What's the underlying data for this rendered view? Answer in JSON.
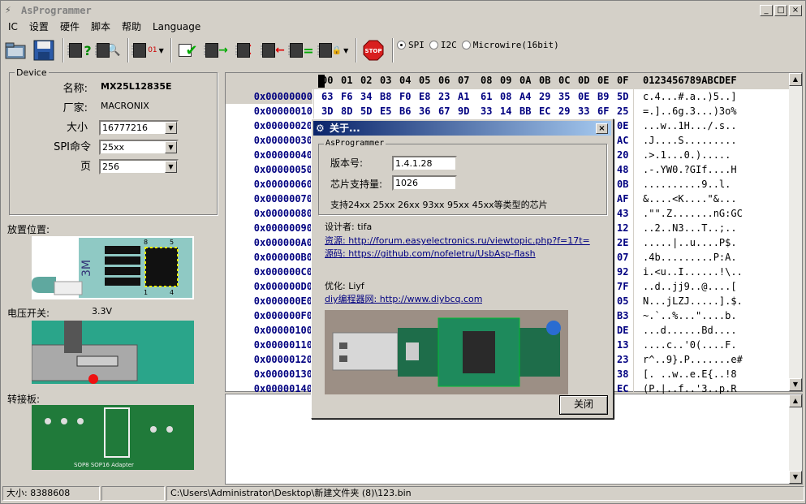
{
  "window": {
    "title": "AsProgrammer",
    "min": "_",
    "max": "□",
    "close": "×"
  },
  "menu": [
    "IC",
    "设置",
    "硬件",
    "脚本",
    "帮助",
    "Language"
  ],
  "toolbar": {
    "stop_label": "STOP",
    "protocols": [
      {
        "label": "SPI",
        "selected": true
      },
      {
        "label": "I2C",
        "selected": false
      },
      {
        "label": "Microwire(16bit)",
        "selected": false
      }
    ]
  },
  "device": {
    "legend": "Device",
    "name_label": "名称:",
    "name_value": "MX25L12835E",
    "vendor_label": "厂家:",
    "vendor_value": "MACRONIX",
    "size_label": "大小",
    "size_value": "16777216",
    "spi_label": "SPI命令",
    "spi_value": "25xx",
    "page_label": "页",
    "page_value": "256"
  },
  "left": {
    "placement_label": "放置位置:",
    "voltage_label": "电压开关:",
    "voltage_value": "3.3V",
    "adapter_label": "转接板:",
    "chip_pin_8": "8",
    "chip_pin_5": "5",
    "chip_pin_1": "1",
    "chip_pin_4": "4",
    "chip_logo": "3M",
    "board_text": "SOP8 SOP16 Adapter"
  },
  "hex": {
    "header_cols": [
      "00",
      "01",
      "02",
      "03",
      "04",
      "05",
      "06",
      "07",
      "08",
      "09",
      "0A",
      "0B",
      "0C",
      "0D",
      "0E",
      "0F"
    ],
    "ascii_header": "0123456789ABCDEF",
    "rows": [
      {
        "addr": "0x00000000",
        "bytes": [
          "63",
          "F6",
          "34",
          "B8",
          "F0",
          "E8",
          "23",
          "A1",
          "61",
          "08",
          "A4",
          "29",
          "35",
          "0E",
          "B9",
          "5D"
        ],
        "ascii": "c.4...#.a..)5..]"
      },
      {
        "addr": "0x00000010",
        "bytes": [
          "3D",
          "8D",
          "5D",
          "E5",
          "B6",
          "36",
          "67",
          "9D",
          "33",
          "14",
          "BB",
          "EC",
          "29",
          "33",
          "6F",
          "25"
        ],
        "ascii": "=.]..6g.3...)3o%"
      },
      {
        "addr": "0x00000020",
        "bytes": [
          "",
          "",
          "",
          "",
          "",
          "",
          "",
          "",
          "",
          "",
          "",
          "",
          "",
          "",
          "",
          "0E"
        ],
        "ascii": "...w..1H.../.s.."
      },
      {
        "addr": "0x00000030",
        "bytes": [
          "",
          "",
          "",
          "",
          "",
          "",
          "",
          "",
          "",
          "",
          "",
          "",
          "",
          "",
          "",
          "AC"
        ],
        "ascii": ".J....S........."
      },
      {
        "addr": "0x00000040",
        "bytes": [
          "",
          "",
          "",
          "",
          "",
          "",
          "",
          "",
          "",
          "",
          "",
          "",
          "",
          "",
          "",
          "20"
        ],
        "ascii": ".>.1...0.)....."
      },
      {
        "addr": "0x00000050",
        "bytes": [
          "",
          "",
          "",
          "",
          "",
          "",
          "",
          "",
          "",
          "",
          "",
          "",
          "",
          "",
          "",
          "48"
        ],
        "ascii": ".-.YW0.?GIf....H"
      },
      {
        "addr": "0x00000060",
        "bytes": [
          "",
          "",
          "",
          "",
          "",
          "",
          "",
          "",
          "",
          "",
          "",
          "",
          "",
          "",
          "",
          "0B"
        ],
        "ascii": "..........9..l."
      },
      {
        "addr": "0x00000070",
        "bytes": [
          "",
          "",
          "",
          "",
          "",
          "",
          "",
          "",
          "",
          "",
          "",
          "",
          "",
          "",
          "",
          "AF"
        ],
        "ascii": "&....<K....\"&..."
      },
      {
        "addr": "0x00000080",
        "bytes": [
          "",
          "",
          "",
          "",
          "",
          "",
          "",
          "",
          "",
          "",
          "",
          "",
          "",
          "",
          "",
          "43"
        ],
        "ascii": ".\"\".Z.......nG:GC"
      },
      {
        "addr": "0x00000090",
        "bytes": [
          "",
          "",
          "",
          "",
          "",
          "",
          "",
          "",
          "",
          "",
          "",
          "",
          "",
          "",
          "",
          "12"
        ],
        "ascii": "..2..N3...T..;.."
      },
      {
        "addr": "0x000000A0",
        "bytes": [
          "",
          "",
          "",
          "",
          "",
          "",
          "",
          "",
          "",
          "",
          "",
          "",
          "",
          "",
          "",
          "2E"
        ],
        "ascii": ".....|..u....P$."
      },
      {
        "addr": "0x000000B0",
        "bytes": [
          "",
          "",
          "",
          "",
          "",
          "",
          "",
          "",
          "",
          "",
          "",
          "",
          "",
          "",
          "",
          "07"
        ],
        "ascii": ".4b.........P:A."
      },
      {
        "addr": "0x000000C0",
        "bytes": [
          "",
          "",
          "",
          "",
          "",
          "",
          "",
          "",
          "",
          "",
          "",
          "",
          "",
          "",
          "",
          "92"
        ],
        "ascii": "i.<u..I......!\\.."
      },
      {
        "addr": "0x000000D0",
        "bytes": [
          "",
          "",
          "",
          "",
          "",
          "",
          "",
          "",
          "",
          "",
          "",
          "",
          "",
          "",
          "",
          "7F"
        ],
        "ascii": "..d..jj9..@....["
      },
      {
        "addr": "0x000000E0",
        "bytes": [
          "",
          "",
          "",
          "",
          "",
          "",
          "",
          "",
          "",
          "",
          "",
          "",
          "",
          "",
          "",
          "05"
        ],
        "ascii": "N...jLZJ.....].$."
      },
      {
        "addr": "0x000000F0",
        "bytes": [
          "",
          "",
          "",
          "",
          "",
          "",
          "",
          "",
          "",
          "",
          "",
          "",
          "",
          "",
          "",
          "B3"
        ],
        "ascii": "~.`..%...\"....b."
      },
      {
        "addr": "0x00000100",
        "bytes": [
          "",
          "",
          "",
          "",
          "",
          "",
          "",
          "",
          "",
          "",
          "",
          "",
          "",
          "",
          "",
          "DE"
        ],
        "ascii": "...d......Bd...."
      },
      {
        "addr": "0x00000110",
        "bytes": [
          "",
          "",
          "",
          "",
          "",
          "",
          "",
          "",
          "",
          "",
          "",
          "",
          "",
          "",
          "",
          "13"
        ],
        "ascii": "....c..'0(....F."
      },
      {
        "addr": "0x00000120",
        "bytes": [
          "",
          "",
          "",
          "",
          "",
          "",
          "",
          "",
          "",
          "",
          "",
          "",
          "",
          "",
          "",
          "23"
        ],
        "ascii": "r^..9}.P.......e#"
      },
      {
        "addr": "0x00000130",
        "bytes": [
          "",
          "",
          "",
          "",
          "",
          "",
          "",
          "",
          "",
          "",
          "",
          "",
          "",
          "",
          "",
          "38"
        ],
        "ascii": "[. ..w..e.E{..!8"
      },
      {
        "addr": "0x00000140",
        "bytes": [
          "",
          "",
          "",
          "",
          "",
          "",
          "",
          "",
          "",
          "",
          "",
          "",
          "",
          "",
          "",
          "EC"
        ],
        "ascii": "(P.|..f..'3..p.R"
      }
    ]
  },
  "status": {
    "size": "大小: 8388608",
    "path": "C:\\Users\\Administrator\\Desktop\\新建文件夹 (8)\\123.bin"
  },
  "about": {
    "title": "关于...",
    "group": "AsProgrammer",
    "version_label": "版本号:",
    "version_value": "1.4.1.28",
    "chips_label": "芯片支持量:",
    "chips_value": "1026",
    "support_text": "支持24xx 25xx 26xx 93xx 95xx 45xx等类型的芯片",
    "designer": "设计者: tifa",
    "source_link": "资源: http://forum.easyelectronics.ru/viewtopic.php?f=17t=",
    "code_link": "源码: https://github.com/nofeletru/UsbAsp-flash",
    "optimizer": "优化: Liyf",
    "diy_link": "diy编程器网: http://www.diybcq.com",
    "ok_button": "关闭"
  }
}
